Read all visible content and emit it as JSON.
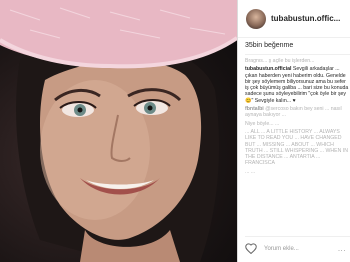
{
  "post": {
    "username": "tubabustun.offic...",
    "likes": "35bin beğenme",
    "caption_user": "tubabustun.official",
    "caption_text": "Sevgili arkadaşlar ... çıkan haberden yeni haberim oldu. Genelde bir şey söylemem biliyorsunuz ama bu sefer iş çok büyümüş galiba ... bari size bu konuda sadece şunu söyleyebilirim \"çok öyle bir şey😊\" Sevgiyle kalın... ♥",
    "top_comment": "Bragnıs... ş açile bu işlerden..."
  },
  "comments": [
    {
      "user": "fbntalbi",
      "text": "@sercoso bakın bey seni ... nasıl aynaya bakıyor ..."
    },
    {
      "user": "",
      "text": "Niye böyle... ..."
    },
    {
      "user": "",
      "text": "... ALL ... A LITTLE HISTORY ... ALWAYS LIKE TO READ YOU ... HAVE CHANGED BUT ... MISSING ... ABOUT ... WHICH TRUTH ... STILL WHISPERING ... WHEN IN THE DISTANCE ... ANTARTIA ... FRANCISCA"
    },
    {
      "user": "",
      "text": "... ..."
    }
  ],
  "actions": {
    "comment_placeholder": "Yorum ekle...",
    "more": "..."
  }
}
